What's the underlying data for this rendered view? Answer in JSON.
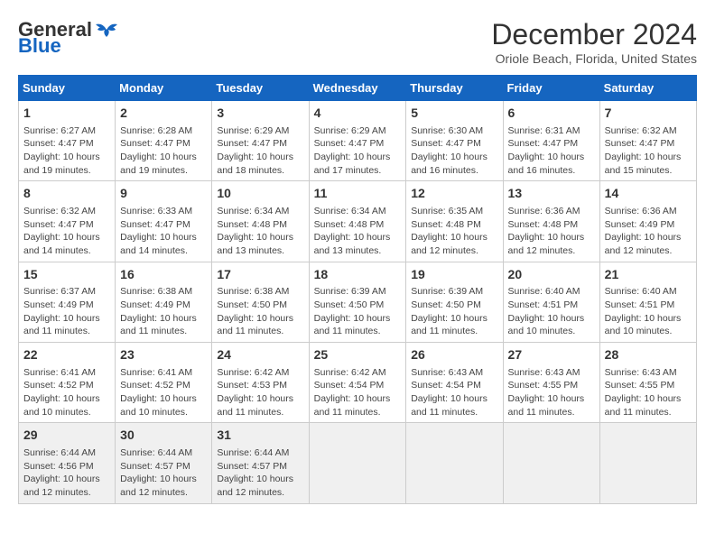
{
  "header": {
    "logo_general": "General",
    "logo_blue": "Blue",
    "month_title": "December 2024",
    "location": "Oriole Beach, Florida, United States"
  },
  "days_of_week": [
    "Sunday",
    "Monday",
    "Tuesday",
    "Wednesday",
    "Thursday",
    "Friday",
    "Saturday"
  ],
  "weeks": [
    [
      {
        "day": "1",
        "info": "Sunrise: 6:27 AM\nSunset: 4:47 PM\nDaylight: 10 hours and 19 minutes."
      },
      {
        "day": "2",
        "info": "Sunrise: 6:28 AM\nSunset: 4:47 PM\nDaylight: 10 hours and 19 minutes."
      },
      {
        "day": "3",
        "info": "Sunrise: 6:29 AM\nSunset: 4:47 PM\nDaylight: 10 hours and 18 minutes."
      },
      {
        "day": "4",
        "info": "Sunrise: 6:29 AM\nSunset: 4:47 PM\nDaylight: 10 hours and 17 minutes."
      },
      {
        "day": "5",
        "info": "Sunrise: 6:30 AM\nSunset: 4:47 PM\nDaylight: 10 hours and 16 minutes."
      },
      {
        "day": "6",
        "info": "Sunrise: 6:31 AM\nSunset: 4:47 PM\nDaylight: 10 hours and 16 minutes."
      },
      {
        "day": "7",
        "info": "Sunrise: 6:32 AM\nSunset: 4:47 PM\nDaylight: 10 hours and 15 minutes."
      }
    ],
    [
      {
        "day": "8",
        "info": "Sunrise: 6:32 AM\nSunset: 4:47 PM\nDaylight: 10 hours and 14 minutes."
      },
      {
        "day": "9",
        "info": "Sunrise: 6:33 AM\nSunset: 4:47 PM\nDaylight: 10 hours and 14 minutes."
      },
      {
        "day": "10",
        "info": "Sunrise: 6:34 AM\nSunset: 4:48 PM\nDaylight: 10 hours and 13 minutes."
      },
      {
        "day": "11",
        "info": "Sunrise: 6:34 AM\nSunset: 4:48 PM\nDaylight: 10 hours and 13 minutes."
      },
      {
        "day": "12",
        "info": "Sunrise: 6:35 AM\nSunset: 4:48 PM\nDaylight: 10 hours and 12 minutes."
      },
      {
        "day": "13",
        "info": "Sunrise: 6:36 AM\nSunset: 4:48 PM\nDaylight: 10 hours and 12 minutes."
      },
      {
        "day": "14",
        "info": "Sunrise: 6:36 AM\nSunset: 4:49 PM\nDaylight: 10 hours and 12 minutes."
      }
    ],
    [
      {
        "day": "15",
        "info": "Sunrise: 6:37 AM\nSunset: 4:49 PM\nDaylight: 10 hours and 11 minutes."
      },
      {
        "day": "16",
        "info": "Sunrise: 6:38 AM\nSunset: 4:49 PM\nDaylight: 10 hours and 11 minutes."
      },
      {
        "day": "17",
        "info": "Sunrise: 6:38 AM\nSunset: 4:50 PM\nDaylight: 10 hours and 11 minutes."
      },
      {
        "day": "18",
        "info": "Sunrise: 6:39 AM\nSunset: 4:50 PM\nDaylight: 10 hours and 11 minutes."
      },
      {
        "day": "19",
        "info": "Sunrise: 6:39 AM\nSunset: 4:50 PM\nDaylight: 10 hours and 11 minutes."
      },
      {
        "day": "20",
        "info": "Sunrise: 6:40 AM\nSunset: 4:51 PM\nDaylight: 10 hours and 10 minutes."
      },
      {
        "day": "21",
        "info": "Sunrise: 6:40 AM\nSunset: 4:51 PM\nDaylight: 10 hours and 10 minutes."
      }
    ],
    [
      {
        "day": "22",
        "info": "Sunrise: 6:41 AM\nSunset: 4:52 PM\nDaylight: 10 hours and 10 minutes."
      },
      {
        "day": "23",
        "info": "Sunrise: 6:41 AM\nSunset: 4:52 PM\nDaylight: 10 hours and 10 minutes."
      },
      {
        "day": "24",
        "info": "Sunrise: 6:42 AM\nSunset: 4:53 PM\nDaylight: 10 hours and 11 minutes."
      },
      {
        "day": "25",
        "info": "Sunrise: 6:42 AM\nSunset: 4:54 PM\nDaylight: 10 hours and 11 minutes."
      },
      {
        "day": "26",
        "info": "Sunrise: 6:43 AM\nSunset: 4:54 PM\nDaylight: 10 hours and 11 minutes."
      },
      {
        "day": "27",
        "info": "Sunrise: 6:43 AM\nSunset: 4:55 PM\nDaylight: 10 hours and 11 minutes."
      },
      {
        "day": "28",
        "info": "Sunrise: 6:43 AM\nSunset: 4:55 PM\nDaylight: 10 hours and 11 minutes."
      }
    ],
    [
      {
        "day": "29",
        "info": "Sunrise: 6:44 AM\nSunset: 4:56 PM\nDaylight: 10 hours and 12 minutes."
      },
      {
        "day": "30",
        "info": "Sunrise: 6:44 AM\nSunset: 4:57 PM\nDaylight: 10 hours and 12 minutes."
      },
      {
        "day": "31",
        "info": "Sunrise: 6:44 AM\nSunset: 4:57 PM\nDaylight: 10 hours and 12 minutes."
      },
      {
        "day": "",
        "info": ""
      },
      {
        "day": "",
        "info": ""
      },
      {
        "day": "",
        "info": ""
      },
      {
        "day": "",
        "info": ""
      }
    ]
  ]
}
